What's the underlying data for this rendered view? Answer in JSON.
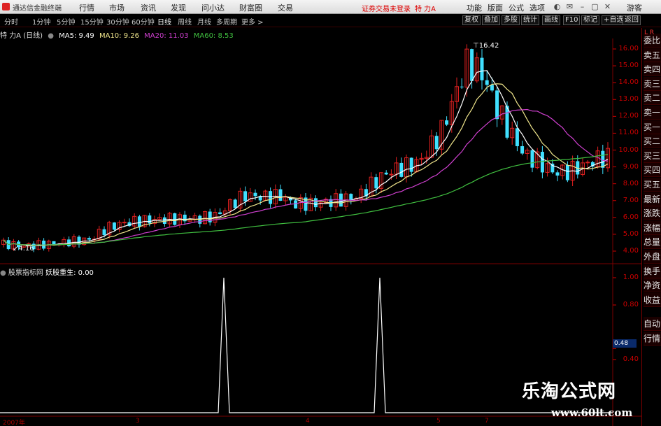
{
  "topbar": {
    "app_title": "通达信金融终端",
    "menus": [
      "行情",
      "市场",
      "资讯",
      "发现",
      "问小达",
      "财富圈",
      "交易"
    ],
    "login_status": "证券交易未登录",
    "stock_title": "特 力A",
    "right_menus": [
      "功能",
      "版面",
      "公式",
      "选项"
    ],
    "guest": "游客"
  },
  "period_bar": {
    "periods": [
      "分时",
      "1分钟",
      "5分钟",
      "15分钟",
      "30分钟",
      "60分钟",
      "日线",
      "周线",
      "月线",
      "多周期",
      "更多 >"
    ],
    "active": "日线",
    "tools": [
      "复权",
      "叠加",
      "多股",
      "统计",
      "画线",
      "F10",
      "标记",
      "+自选",
      "返回"
    ]
  },
  "info_line": {
    "stock": "特 力A (日线)",
    "ma5": "MA5: 9.49",
    "ma10": "MA10: 9.26",
    "ma20": "MA20: 11.03",
    "ma60": "MA60: 8.53"
  },
  "indicator_line": {
    "name": "股票指标网",
    "formula": "妖股重生: 0.00"
  },
  "right_panel": {
    "items": [
      "委比",
      "卖五",
      "卖四",
      "卖三",
      "卖二",
      "卖一",
      "买一",
      "买二",
      "买三",
      "买四",
      "买五",
      "最新",
      "涨跌",
      "涨幅",
      "总量",
      "外盘",
      "换手",
      "净资",
      "收益",
      "自动",
      "行情"
    ],
    "corner": "L R"
  },
  "price_axis": {
    "labels": [
      "16.00",
      "15.00",
      "14.00",
      "13.00",
      "12.00",
      "11.00",
      "10.00",
      "9.00",
      "8.00",
      "7.00",
      "6.00",
      "5.00",
      "4.00"
    ],
    "values": [
      16,
      15,
      14,
      13,
      12,
      11,
      10,
      9,
      8,
      7,
      6,
      5,
      4
    ]
  },
  "ind_axis": {
    "labels": [
      "1.00",
      "0.80",
      "0.48",
      "0.40"
    ],
    "values": [
      1.0,
      0.8,
      0.48,
      0.4
    ],
    "cursor_value": "0.48"
  },
  "annotations": {
    "high": "16.42",
    "low": "4.16"
  },
  "date_axis": {
    "labels": [
      "2007年",
      "3",
      "4",
      "5",
      "7"
    ]
  },
  "watermark": {
    "main": "乐淘公式网",
    "url": "www.60lt.com"
  },
  "colors": {
    "up": "#e02020",
    "down": "#40e0ff",
    "ma5": "#ffffff",
    "ma10": "#f0e68c",
    "ma20": "#d040d0",
    "ma60": "#40c040",
    "axis": "#c00000"
  },
  "chart_data": {
    "type": "line",
    "series": [
      {
        "name": "妖股重生",
        "x": [
          1,
          95,
          176
        ],
        "values": [
          1,
          1,
          0
        ]
      }
    ]
  }
}
